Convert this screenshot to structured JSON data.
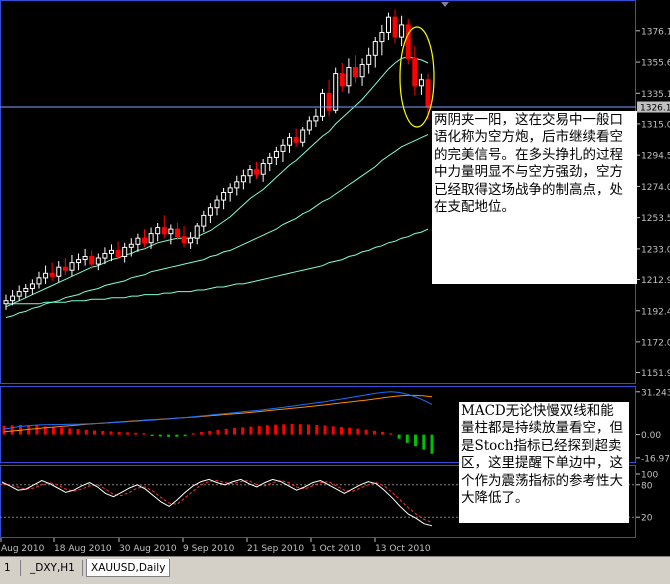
{
  "colors": {
    "background": "#000000",
    "frame": "#2f4fd8",
    "axis_text": "#c0c0c0",
    "bull_candle": "#ffffff",
    "bear_candle": "#ff0000",
    "moving_averages": "#7fffd4",
    "macd_positive": "#ff0000",
    "macd_negative": "#00c000",
    "macd_line": "#1e6fff",
    "signal_line": "#ff8c00",
    "stoch_main": "#ffffff",
    "stoch_signal": "#ff3030",
    "ellipse": "#ffff00",
    "price_line": "#7f9fff"
  },
  "chart_data": [
    {
      "type": "candlestick",
      "name_panel": "price",
      "ylim": [
        1145,
        1395
      ],
      "y_ticks": [
        "1376.1",
        "1355.6",
        "1335.1",
        "1315.0",
        "1294.5",
        "1274.0",
        "1253.5",
        "1233.0",
        "1212.9",
        "1192.4",
        "1172.0",
        "1151.9"
      ],
      "current_price_label": "1326.1",
      "grid": false,
      "candles": [
        {
          "o": 1197,
          "h": 1203,
          "l": 1193,
          "c": 1199
        },
        {
          "o": 1199,
          "h": 1206,
          "l": 1196,
          "c": 1202
        },
        {
          "o": 1202,
          "h": 1209,
          "l": 1199,
          "c": 1205
        },
        {
          "o": 1205,
          "h": 1210,
          "l": 1201,
          "c": 1207
        },
        {
          "o": 1207,
          "h": 1213,
          "l": 1203,
          "c": 1210
        },
        {
          "o": 1210,
          "h": 1218,
          "l": 1207,
          "c": 1214
        },
        {
          "o": 1214,
          "h": 1222,
          "l": 1210,
          "c": 1217
        },
        {
          "o": 1217,
          "h": 1224,
          "l": 1212,
          "c": 1215
        },
        {
          "o": 1215,
          "h": 1225,
          "l": 1211,
          "c": 1221
        },
        {
          "o": 1221,
          "h": 1227,
          "l": 1216,
          "c": 1219
        },
        {
          "o": 1219,
          "h": 1229,
          "l": 1215,
          "c": 1224
        },
        {
          "o": 1224,
          "h": 1230,
          "l": 1219,
          "c": 1226
        },
        {
          "o": 1226,
          "h": 1233,
          "l": 1222,
          "c": 1228
        },
        {
          "o": 1228,
          "h": 1232,
          "l": 1220,
          "c": 1223
        },
        {
          "o": 1223,
          "h": 1230,
          "l": 1219,
          "c": 1227
        },
        {
          "o": 1227,
          "h": 1234,
          "l": 1223,
          "c": 1230
        },
        {
          "o": 1230,
          "h": 1236,
          "l": 1225,
          "c": 1232
        },
        {
          "o": 1232,
          "h": 1238,
          "l": 1226,
          "c": 1228
        },
        {
          "o": 1228,
          "h": 1237,
          "l": 1224,
          "c": 1234
        },
        {
          "o": 1234,
          "h": 1240,
          "l": 1228,
          "c": 1236
        },
        {
          "o": 1236,
          "h": 1243,
          "l": 1231,
          "c": 1240
        },
        {
          "o": 1240,
          "h": 1246,
          "l": 1234,
          "c": 1237
        },
        {
          "o": 1237,
          "h": 1247,
          "l": 1233,
          "c": 1243
        },
        {
          "o": 1243,
          "h": 1250,
          "l": 1238,
          "c": 1247
        },
        {
          "o": 1247,
          "h": 1255,
          "l": 1240,
          "c": 1243
        },
        {
          "o": 1243,
          "h": 1249,
          "l": 1236,
          "c": 1246
        },
        {
          "o": 1246,
          "h": 1250,
          "l": 1239,
          "c": 1241
        },
        {
          "o": 1241,
          "h": 1248,
          "l": 1234,
          "c": 1237
        },
        {
          "o": 1237,
          "h": 1244,
          "l": 1233,
          "c": 1240
        },
        {
          "o": 1240,
          "h": 1250,
          "l": 1236,
          "c": 1248
        },
        {
          "o": 1248,
          "h": 1258,
          "l": 1244,
          "c": 1255
        },
        {
          "o": 1255,
          "h": 1263,
          "l": 1250,
          "c": 1260
        },
        {
          "o": 1260,
          "h": 1268,
          "l": 1255,
          "c": 1265
        },
        {
          "o": 1265,
          "h": 1273,
          "l": 1259,
          "c": 1270
        },
        {
          "o": 1270,
          "h": 1276,
          "l": 1264,
          "c": 1273
        },
        {
          "o": 1273,
          "h": 1281,
          "l": 1268,
          "c": 1277
        },
        {
          "o": 1277,
          "h": 1285,
          "l": 1272,
          "c": 1281
        },
        {
          "o": 1281,
          "h": 1288,
          "l": 1276,
          "c": 1285
        },
        {
          "o": 1285,
          "h": 1290,
          "l": 1279,
          "c": 1282
        },
        {
          "o": 1282,
          "h": 1292,
          "l": 1277,
          "c": 1289
        },
        {
          "o": 1289,
          "h": 1296,
          "l": 1284,
          "c": 1293
        },
        {
          "o": 1293,
          "h": 1300,
          "l": 1288,
          "c": 1297
        },
        {
          "o": 1297,
          "h": 1305,
          "l": 1290,
          "c": 1301
        },
        {
          "o": 1301,
          "h": 1309,
          "l": 1296,
          "c": 1306
        },
        {
          "o": 1306,
          "h": 1312,
          "l": 1300,
          "c": 1303
        },
        {
          "o": 1303,
          "h": 1313,
          "l": 1300,
          "c": 1311
        },
        {
          "o": 1311,
          "h": 1320,
          "l": 1308,
          "c": 1317
        },
        {
          "o": 1317,
          "h": 1325,
          "l": 1313,
          "c": 1320
        },
        {
          "o": 1320,
          "h": 1338,
          "l": 1317,
          "c": 1335
        },
        {
          "o": 1335,
          "h": 1344,
          "l": 1320,
          "c": 1324
        },
        {
          "o": 1324,
          "h": 1352,
          "l": 1322,
          "c": 1348
        },
        {
          "o": 1348,
          "h": 1355,
          "l": 1336,
          "c": 1340
        },
        {
          "o": 1340,
          "h": 1358,
          "l": 1335,
          "c": 1352
        },
        {
          "o": 1352,
          "h": 1360,
          "l": 1342,
          "c": 1346
        },
        {
          "o": 1346,
          "h": 1358,
          "l": 1340,
          "c": 1354
        },
        {
          "o": 1354,
          "h": 1365,
          "l": 1348,
          "c": 1360
        },
        {
          "o": 1360,
          "h": 1372,
          "l": 1352,
          "c": 1369
        },
        {
          "o": 1369,
          "h": 1380,
          "l": 1360,
          "c": 1375
        },
        {
          "o": 1375,
          "h": 1388,
          "l": 1370,
          "c": 1385
        },
        {
          "o": 1385,
          "h": 1390,
          "l": 1368,
          "c": 1372
        },
        {
          "o": 1372,
          "h": 1386,
          "l": 1366,
          "c": 1380
        },
        {
          "o": 1380,
          "h": 1384,
          "l": 1354,
          "c": 1358
        },
        {
          "o": 1358,
          "h": 1366,
          "l": 1334,
          "c": 1340
        },
        {
          "o": 1340,
          "h": 1348,
          "l": 1334,
          "c": 1344
        },
        {
          "o": 1344,
          "h": 1348,
          "l": 1318,
          "c": 1326
        }
      ],
      "ma_fast": [
        1195,
        1197,
        1199,
        1201,
        1203,
        1205,
        1207,
        1209,
        1211,
        1213,
        1215,
        1217,
        1219,
        1221,
        1222,
        1224,
        1226,
        1227,
        1229,
        1230,
        1232,
        1233,
        1235,
        1237,
        1238,
        1239,
        1240,
        1240,
        1240,
        1241,
        1243,
        1245,
        1248,
        1251,
        1254,
        1258,
        1262,
        1266,
        1269,
        1272,
        1276,
        1280,
        1284,
        1288,
        1291,
        1295,
        1299,
        1303,
        1307,
        1310,
        1315,
        1319,
        1323,
        1327,
        1331,
        1336,
        1341,
        1346,
        1351,
        1355,
        1358,
        1359,
        1358,
        1357,
        1355
      ],
      "ma_mid": [
        1188,
        1189,
        1191,
        1192,
        1194,
        1195,
        1197,
        1198,
        1199,
        1201,
        1202,
        1203,
        1205,
        1206,
        1207,
        1209,
        1210,
        1211,
        1212,
        1214,
        1215,
        1216,
        1218,
        1219,
        1220,
        1221,
        1222,
        1223,
        1224,
        1225,
        1226,
        1228,
        1229,
        1231,
        1232,
        1234,
        1236,
        1238,
        1240,
        1242,
        1244,
        1246,
        1249,
        1251,
        1253,
        1256,
        1258,
        1261,
        1264,
        1266,
        1269,
        1272,
        1275,
        1278,
        1281,
        1284,
        1287,
        1291,
        1294,
        1297,
        1300,
        1302,
        1304,
        1306,
        1308
      ],
      "ma_slow": [
        1197,
        1197,
        1197,
        1197,
        1197,
        1197,
        1198,
        1198,
        1198,
        1198,
        1199,
        1199,
        1199,
        1200,
        1200,
        1200,
        1201,
        1201,
        1201,
        1202,
        1202,
        1203,
        1203,
        1203,
        1204,
        1204,
        1205,
        1205,
        1205,
        1206,
        1206,
        1207,
        1208,
        1208,
        1209,
        1210,
        1210,
        1211,
        1212,
        1213,
        1214,
        1215,
        1216,
        1217,
        1218,
        1219,
        1220,
        1221,
        1222,
        1224,
        1225,
        1226,
        1228,
        1229,
        1231,
        1232,
        1234,
        1235,
        1237,
        1238,
        1240,
        1241,
        1243,
        1244,
        1246
      ]
    },
    {
      "type": "bar",
      "name_panel": "MACD",
      "ylim": [
        -20,
        34
      ],
      "y_ticks": [
        "31.2436",
        "0.00",
        "-16.9779"
      ],
      "histogram": [
        6.5,
        6.8,
        7.0,
        6.9,
        6.6,
        6.0,
        5.5,
        5.0,
        4.5,
        4.0,
        3.5,
        3.0,
        2.7,
        2.3,
        2.0,
        1.6,
        1.3,
        1.0,
        -1.0,
        -1.4,
        -1.7,
        -1.6,
        -1.2,
        1.0,
        1.8,
        2.6,
        3.4,
        4.2,
        4.8,
        5.3,
        5.8,
        6.3,
        6.8,
        7.2,
        7.5,
        7.8,
        7.6,
        7.4,
        7.0,
        6.6,
        6.0,
        5.5,
        5.0,
        4.4,
        3.6,
        2.8,
        2.0,
        1.0,
        -3.0,
        -6.0,
        -8.5,
        -11.0,
        -14.0
      ],
      "macd_line": [
        4,
        5,
        6,
        6.5,
        7,
        7.2,
        7.3,
        7.4,
        7.5,
        7.6,
        7.8,
        8,
        8.3,
        8.6,
        9,
        9.4,
        9.8,
        10.2,
        10.6,
        11,
        11.4,
        11.9,
        12.4,
        13,
        13.6,
        14.2,
        14.8,
        15.4,
        16,
        16.6,
        17.2,
        17.8,
        18.5,
        19.2,
        20,
        20.8,
        21.6,
        22.4,
        23.2,
        24,
        25,
        26,
        27,
        28,
        29,
        30,
        30.8,
        31.2,
        30.8,
        29.5,
        27.5,
        25,
        22
      ],
      "signal_line": [
        2,
        2.6,
        3.2,
        3.8,
        4.4,
        5,
        5.5,
        6,
        6.5,
        7,
        7.5,
        8,
        8.4,
        8.8,
        9.2,
        9.6,
        10,
        10.4,
        10.8,
        11.2,
        11.6,
        12,
        12.4,
        12.8,
        13.2,
        13.7,
        14.2,
        14.7,
        15.2,
        15.7,
        16.2,
        16.8,
        17.4,
        18,
        18.6,
        19.2,
        19.8,
        20.4,
        21,
        21.7,
        22.4,
        23.1,
        23.8,
        24.5,
        25.2,
        26,
        26.8,
        27.6,
        28.2,
        28.6,
        28.6,
        28.2,
        27.6
      ]
    },
    {
      "type": "line",
      "name_panel": "Stochastic",
      "ylim": [
        0,
        100
      ],
      "y_ticks": [
        "100",
        "80",
        "20"
      ],
      "main_line": [
        85,
        78,
        70,
        72,
        80,
        88,
        82,
        74,
        66,
        70,
        78,
        84,
        76,
        64,
        58,
        66,
        74,
        80,
        72,
        60,
        48,
        40,
        52,
        66,
        78,
        86,
        90,
        84,
        80,
        86,
        90,
        82,
        76,
        84,
        90,
        86,
        78,
        70,
        76,
        84,
        88,
        80,
        72,
        64,
        72,
        80,
        86,
        82,
        70,
        56,
        40,
        26,
        18,
        8,
        4
      ],
      "signal_line": [
        82,
        80,
        76,
        72,
        74,
        80,
        84,
        80,
        72,
        68,
        72,
        78,
        80,
        72,
        62,
        60,
        66,
        74,
        76,
        68,
        56,
        46,
        44,
        56,
        68,
        80,
        86,
        88,
        84,
        82,
        86,
        88,
        80,
        78,
        84,
        88,
        84,
        76,
        72,
        78,
        84,
        86,
        78,
        70,
        68,
        74,
        80,
        84,
        78,
        66,
        52,
        38,
        26,
        16,
        10
      ]
    }
  ],
  "x_labels": [
    "Aug 2010",
    "18 Aug 2010",
    "30 Aug 2010",
    "9 Sep 2010",
    "21 Sep 2010",
    "1 Oct 2010",
    "13 Oct 2010"
  ],
  "annotations": {
    "note_price": "两阴夹一阳，这在交易中一般口语化称为空方炮，后市继续看空的完美信号。在多头挣扎的过程中力量明显不与空方强劲，空方已经取得这场战争的制高点，处在支配地位。",
    "note_indicators": "MACD无论快慢双线和能量柱都是持续放量看空，但是Stoch指标已经探到超卖区，这里提醒下单边中，这个作为震荡指标的参考性大大降低了。"
  },
  "tabs": [
    "1",
    "_DXY,H1",
    "XAUUSD,Daily"
  ],
  "active_tab": "XAUUSD,Daily"
}
